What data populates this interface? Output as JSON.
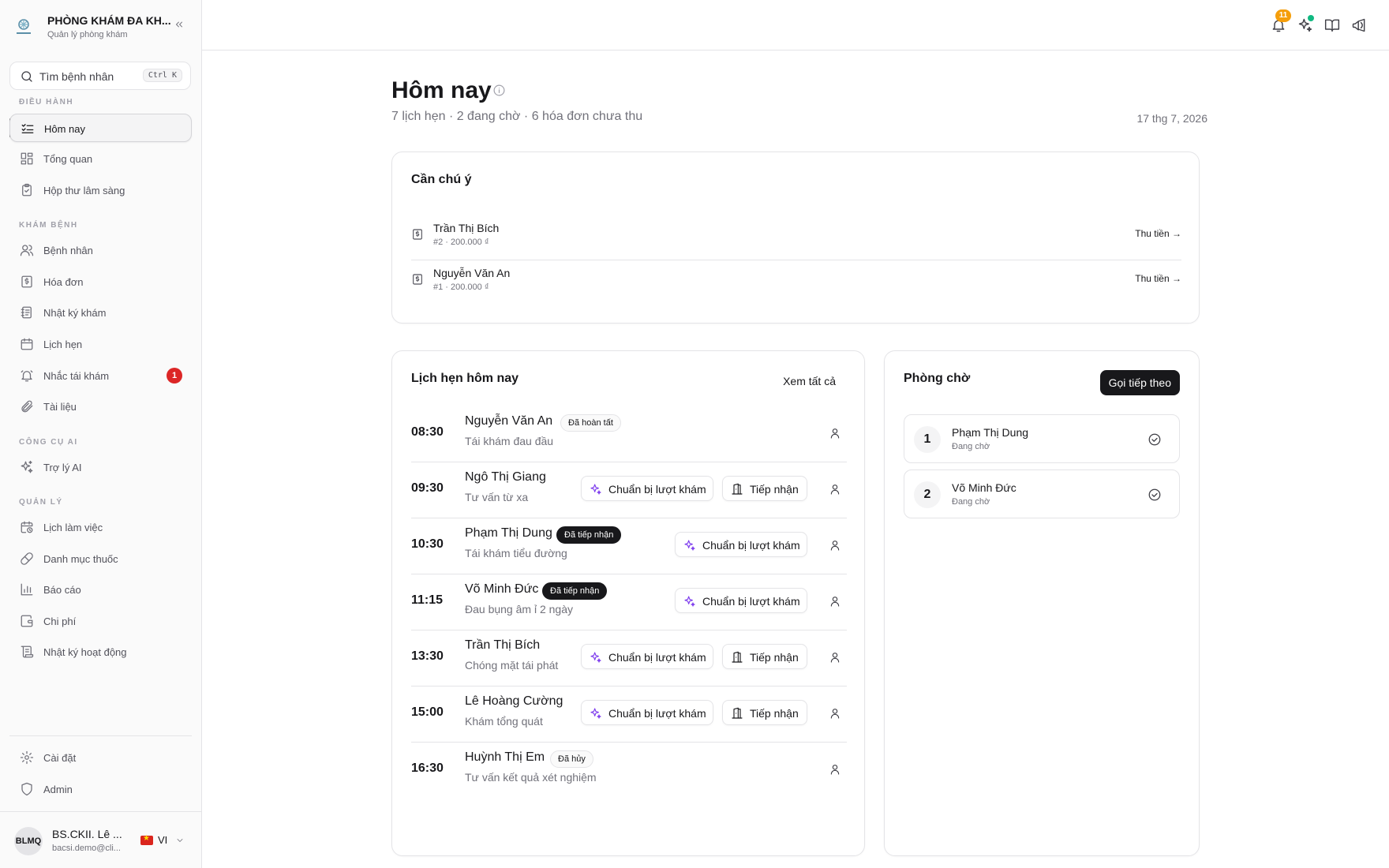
{
  "brand": {
    "title": "PHÒNG KHÁM ĐA KH...",
    "subtitle": "Quản lý phòng khám"
  },
  "search": {
    "placeholder": "Tìm bệnh nhân",
    "shortcut": "Ctrl K"
  },
  "sidebar": {
    "sections": {
      "operations": "ĐIỀU HÀNH",
      "clinical": "KHÁM BỆNH",
      "ai_tools": "CÔNG CỤ AI",
      "management": "QUẢN LÝ"
    },
    "items": {
      "today": "Hôm nay",
      "overview": "Tổng quan",
      "clinical_inbox": "Hộp thư lâm sàng",
      "patients": "Bệnh nhân",
      "invoices": "Hóa đơn",
      "visit_log": "Nhật ký khám",
      "appointments": "Lịch hẹn",
      "recall": "Nhắc tái khám",
      "recall_badge": "1",
      "documents": "Tài liệu",
      "ai_assistant": "Trợ lý AI",
      "schedule": "Lịch làm việc",
      "drug_catalog": "Danh mục thuốc",
      "reports": "Báo cáo",
      "expenses": "Chi phí",
      "activity_log": "Nhật ký hoạt động",
      "settings": "Cài đặt",
      "admin": "Admin"
    }
  },
  "user": {
    "initials": "BLMQ",
    "name": "BS.CKII. Lê ...",
    "email": "bacsi.demo@cli...",
    "language": "VI"
  },
  "topbar": {
    "notification_count": "11"
  },
  "page": {
    "title": "Hôm nay",
    "subtitle": "7 lịch hẹn · 2 đang chờ · 6 hóa đơn chưa thu",
    "date": "17 thg 7, 2026"
  },
  "attention": {
    "title": "Cần chú ý",
    "action_label": "Thu tiền",
    "items": [
      {
        "name": "Trần Thị Bích",
        "meta": "#2 · 200.000 ₫"
      },
      {
        "name": "Nguyễn Văn An",
        "meta": "#1 · 200.000 ₫"
      }
    ]
  },
  "appointments": {
    "title": "Lịch hẹn hôm nay",
    "see_all": "Xem tất cả",
    "prepare_label": "Chuẩn bị lượt khám",
    "checkin_label": "Tiếp nhận",
    "rows": [
      {
        "time": "08:30",
        "name": "Nguyễn Văn An",
        "note": "Tái khám đau đầu",
        "status": "Đã hoàn tất"
      },
      {
        "time": "09:30",
        "name": "Ngô Thị Giang",
        "note": "Tư vấn từ xa"
      },
      {
        "time": "10:30",
        "name": "Phạm Thị Dung",
        "note": "Tái khám tiểu đường",
        "status": "Đã tiếp nhận"
      },
      {
        "time": "11:15",
        "name": "Võ Minh Đức",
        "note": "Đau bụng âm ỉ 2 ngày",
        "status": "Đã tiếp nhận"
      },
      {
        "time": "13:30",
        "name": "Trần Thị Bích",
        "note": "Chóng mặt tái phát"
      },
      {
        "time": "15:00",
        "name": "Lê Hoàng Cường",
        "note": "Khám tổng quát"
      },
      {
        "time": "16:30",
        "name": "Huỳnh Thị Em",
        "note": "Tư vấn kết quả xét nghiệm",
        "status": "Đã hủy"
      }
    ]
  },
  "waiting_room": {
    "title": "Phòng chờ",
    "call_next": "Gọi tiếp theo",
    "items": [
      {
        "number": "1",
        "name": "Phạm Thị Dung",
        "status": "Đang chờ"
      },
      {
        "number": "2",
        "name": "Võ Minh Đức",
        "status": "Đang chờ"
      }
    ]
  },
  "colors": {
    "accent": "#18181b",
    "sparkle": "#7c3aed",
    "badge_red": "#dc2626",
    "badge_amber": "#f59e0b"
  }
}
